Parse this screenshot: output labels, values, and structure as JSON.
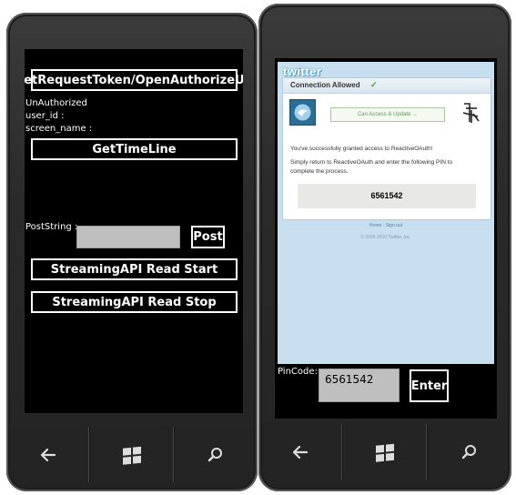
{
  "left_phone": {
    "buttons": {
      "get_request_token": "GetRequestToken/OpenAuthorizeUrl",
      "get_timeline": "GetTimeLine",
      "post": "Post",
      "stream_start": "StreamingAPI Read Start",
      "stream_stop": "StreamingAPI Read Stop"
    },
    "status": {
      "auth_state": "UnAuthorized",
      "user_id_label": "user_id :",
      "screen_name_label": "screen_name :"
    },
    "post_label": "PostString :",
    "post_value": ""
  },
  "right_phone": {
    "twitter_logo": "twitter",
    "card_title": "Connection Allowed",
    "check_mark": "✓",
    "access_badge": "Can Access & Update →",
    "success_message": "You've successfully granted access to ReactiveOAuth!",
    "instruction": "Simply return to ReactiveOAuth and enter the following PIN to complete the process.",
    "pin": "6561542",
    "footer_links": {
      "home": "Home",
      "sep": " · ",
      "signout": "Sign out"
    },
    "copyright": "© 2006-2010 Twitter, Inc.",
    "pincode_label": "PinCode:",
    "pincode_value": "6561542",
    "enter_button": "Enter"
  },
  "icons": [
    "back-arrow-icon",
    "windows-logo-icon",
    "search-icon",
    "twitter-bird-icon",
    "app-logo-icon"
  ],
  "colors": {
    "screen": "#000000",
    "button_border": "#ffffff",
    "input_bg": "#bfbfbf",
    "web_bg": "#c7dfee",
    "twitter_blue": "#4aa8d8"
  }
}
